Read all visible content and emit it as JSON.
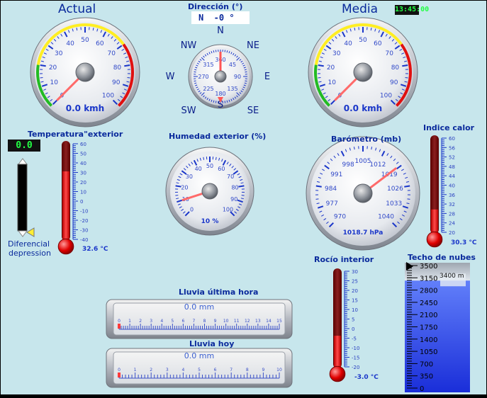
{
  "colors": {
    "panel_bg": "#c7e6ec",
    "text": "#0a2a9c",
    "needle": "#ff7777",
    "digital_bg": "#111111",
    "digital_fg": "#22ff44"
  },
  "clock": "13:45:00",
  "wind_actual": {
    "title": "Actual",
    "ticks": [
      "0",
      "10",
      "20",
      "30",
      "40",
      "50",
      "60",
      "70",
      "80",
      "90",
      "100"
    ],
    "value_text": "0.0 kmh",
    "value": 0
  },
  "wind_avg": {
    "title": "Media",
    "ticks": [
      "0",
      "10",
      "20",
      "30",
      "40",
      "50",
      "60",
      "70",
      "80",
      "90",
      "100"
    ],
    "value_text": "0.0 kmh",
    "value": 0
  },
  "direction": {
    "title": "Dirección (°)",
    "readout": "N  -0 °",
    "cardinals": {
      "n": "N",
      "ne": "NE",
      "e": "E",
      "se": "SE",
      "s": "S",
      "sw": "SW",
      "w": "W",
      "nw": "NW"
    },
    "ticks": [
      "360",
      "45",
      "90",
      "135",
      "180",
      "225",
      "270",
      "315"
    ],
    "value_deg": 0
  },
  "outdoor_temp": {
    "title": "Temperatura\"exterior",
    "ticks": [
      "60",
      "50",
      "40",
      "30",
      "20",
      "10",
      "0",
      "-10",
      "-20",
      "-30",
      "-40"
    ],
    "value_text": "32.6 °C",
    "value": 32.6
  },
  "differential": {
    "readout": "0.0",
    "label_1": "Diferencial",
    "label_2": "depression"
  },
  "humidity": {
    "title": "Humedad exterior (%)",
    "ticks": [
      "0",
      "10",
      "20",
      "30",
      "40",
      "50",
      "60",
      "70",
      "80",
      "90",
      "100"
    ],
    "value_text": "10 %",
    "value": 10
  },
  "barometer": {
    "title": "Barómetro (mb)",
    "ticks": [
      "970",
      "977",
      "984",
      "991",
      "998",
      "1005",
      "1012",
      "1019",
      "1026",
      "1033",
      "1040"
    ],
    "value_text": "1018.7 hPa",
    "value": 1018.7
  },
  "heat_index": {
    "title": "Indice calor",
    "ticks": [
      "60",
      "56",
      "52",
      "48",
      "44",
      "40",
      "36",
      "32",
      "28",
      "24",
      "20"
    ],
    "value_text": "30.3 °C",
    "value": 30.3
  },
  "dew_point": {
    "title": "Rocío interior",
    "ticks": [
      "30",
      "25",
      "20",
      "15",
      "10",
      "5",
      "0",
      "-5",
      "-10",
      "-15",
      "-20"
    ],
    "value_text": "-3.0 °C",
    "value": -3.0
  },
  "rain_hour": {
    "title": "Lluvia última hora",
    "value_text": "0.0 mm",
    "ticks": [
      "0",
      "1",
      "2",
      "3",
      "4",
      "5",
      "6",
      "7",
      "8",
      "9",
      "10",
      "11",
      "12",
      "13",
      "14",
      "15"
    ],
    "value": 0
  },
  "rain_today": {
    "title": "Lluvia hoy",
    "value_text": "0.0 mm",
    "ticks": [
      "0",
      "1",
      "2",
      "3",
      "4",
      "5",
      "6",
      "7",
      "8",
      "9",
      "10"
    ],
    "value": 0
  },
  "cloud_base": {
    "title": "Techo de nubes",
    "ticks": [
      "3500",
      "3150",
      "2800",
      "2450",
      "2100",
      "1750",
      "1400",
      "1050",
      "700",
      "350",
      "0"
    ],
    "value_text": "3400 m",
    "value": 3400
  }
}
